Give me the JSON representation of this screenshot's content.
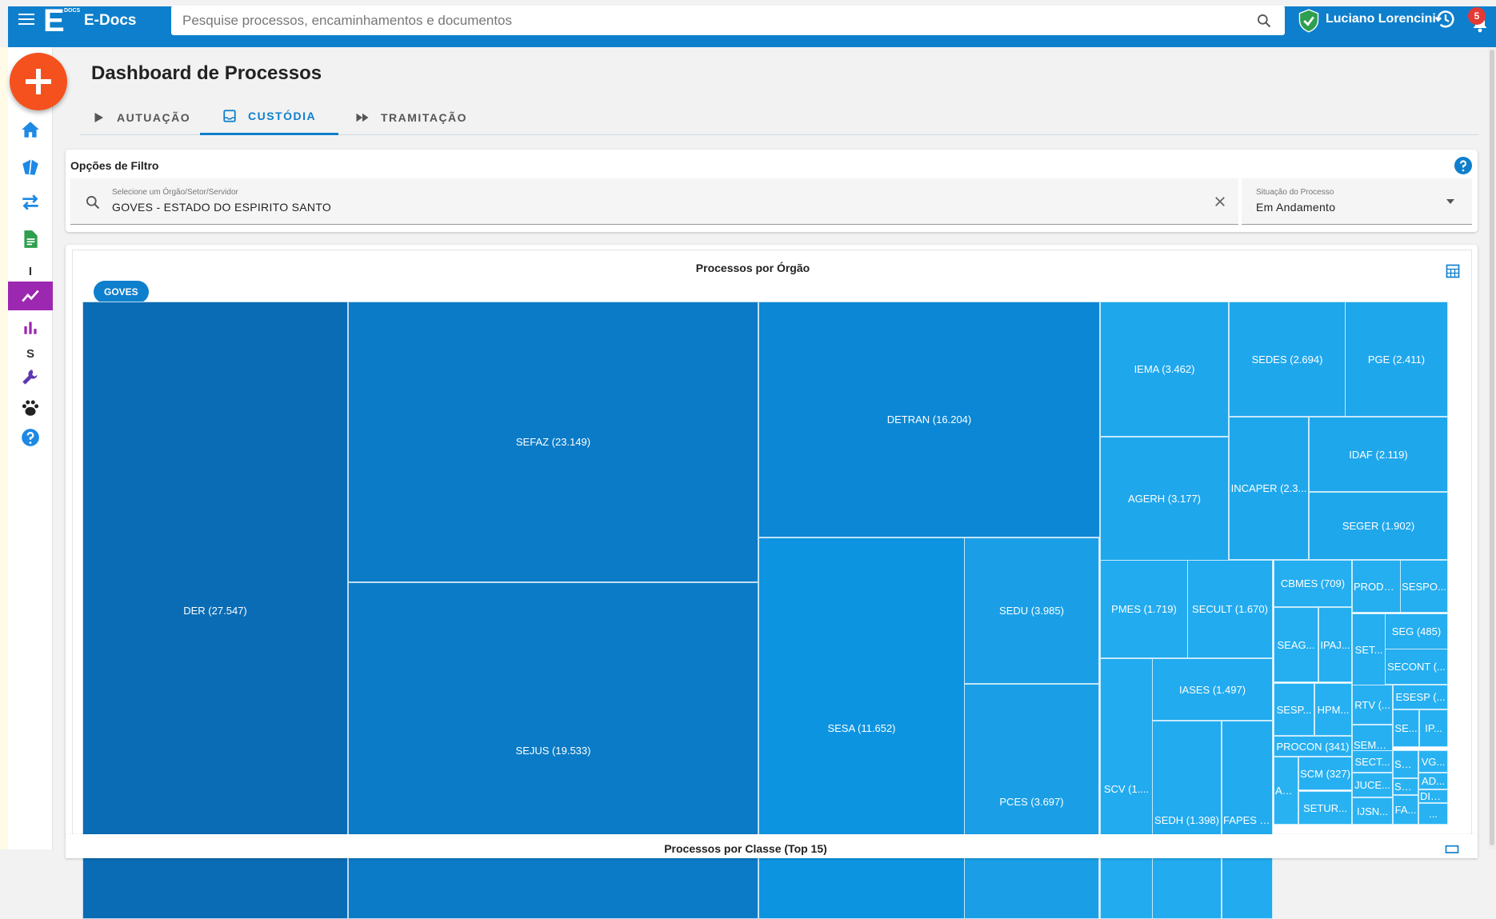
{
  "header": {
    "app_name": "E-Docs",
    "logo_letter": "E",
    "logo_docs": "DOCS",
    "search_placeholder": "Pesquise processos, encaminhamentos e documentos",
    "user_name": "Luciano Lorencini",
    "notification_count": "5"
  },
  "colors": {
    "primary": "#0e7fcc",
    "fab": "#f4511e",
    "active_rail": "#9c27b0"
  },
  "sidebar": {
    "letters": {
      "i": "I",
      "s": "S"
    },
    "icons": [
      "home-icon",
      "box-icon",
      "transfer-icon",
      "document-icon",
      "trend-chart-icon",
      "bar-chart-icon",
      "wrench-icon",
      "paw-icon",
      "help-icon"
    ]
  },
  "page": {
    "title": "Dashboard de Processos",
    "tabs": [
      {
        "label": "AUTUAÇÃO",
        "active": false
      },
      {
        "label": "CUSTÓDIA",
        "active": true
      },
      {
        "label": "TRAMITAÇÃO",
        "active": false
      }
    ]
  },
  "filter": {
    "title": "Opções de Filtro",
    "org_label": "Selecione um Órgão/Setor/Servidor",
    "org_value": "GOVES - ESTADO DO ESPIRITO SANTO",
    "status_label": "Situação do Processo",
    "status_value": "Em Andamento"
  },
  "chart": {
    "title": "Processos por Órgão",
    "chip": "GOVES",
    "next_title": "Processos por Classe (Top 15)"
  },
  "chart_data": {
    "type": "treemap",
    "title": "Processos por Órgão",
    "items": [
      {
        "label": "DER (27.547)",
        "name": "DER",
        "value": 27547
      },
      {
        "label": "SEFAZ (23.149)",
        "name": "SEFAZ",
        "value": 23149
      },
      {
        "label": "SEJUS (19.533)",
        "name": "SEJUS",
        "value": 19533
      },
      {
        "label": "DETRAN (16.204)",
        "name": "DETRAN",
        "value": 16204
      },
      {
        "label": "SESA (11.652)",
        "name": "SESA",
        "value": 11652
      },
      {
        "label": "SEDU (3.985)",
        "name": "SEDU",
        "value": 3985
      },
      {
        "label": "PCES (3.697)",
        "name": "PCES",
        "value": 3697
      },
      {
        "label": "IEMA (3.462)",
        "name": "IEMA",
        "value": 3462
      },
      {
        "label": "AGERH (3.177)",
        "name": "AGERH",
        "value": 3177
      },
      {
        "label": "SEDES (2.694)",
        "name": "SEDES",
        "value": 2694
      },
      {
        "label": "PGE (2.411)",
        "name": "PGE",
        "value": 2411
      },
      {
        "label": "INCAPER (2.3...",
        "name": "INCAPER"
      },
      {
        "label": "IDAF (2.119)",
        "name": "IDAF",
        "value": 2119
      },
      {
        "label": "SEGER (1.902)",
        "name": "SEGER",
        "value": 1902
      },
      {
        "label": "PMES (1.719)",
        "name": "PMES",
        "value": 1719
      },
      {
        "label": "SECULT (1.670)",
        "name": "SECULT",
        "value": 1670
      },
      {
        "label": "IASES (1.497)",
        "name": "IASES",
        "value": 1497
      },
      {
        "label": "SEDH (1.398)",
        "name": "SEDH",
        "value": 1398
      },
      {
        "label": "SCV (1....",
        "name": "SCV"
      },
      {
        "label": "FAPES (...",
        "name": "FAPES"
      },
      {
        "label": "CBMES (709)",
        "name": "CBMES",
        "value": 709
      },
      {
        "label": "PRODE...",
        "name": "PRODE..."
      },
      {
        "label": "SESPO...",
        "name": "SESPO..."
      },
      {
        "label": "SEAG...",
        "name": "SEAG..."
      },
      {
        "label": "IPAJ...",
        "name": "IPAJ..."
      },
      {
        "label": "SET...",
        "name": "SET..."
      },
      {
        "label": "SEG (485)",
        "name": "SEG",
        "value": 485
      },
      {
        "label": "SECONT (...",
        "name": "SECONT"
      },
      {
        "label": "SESP...",
        "name": "SESP..."
      },
      {
        "label": "HPM...",
        "name": "HPM..."
      },
      {
        "label": "RTV (...",
        "name": "RTV"
      },
      {
        "label": "ESESP (...",
        "name": "ESESP"
      },
      {
        "label": "SEMO...",
        "name": "SEMO..."
      },
      {
        "label": "SE...",
        "name": "SE..."
      },
      {
        "label": "IP...",
        "name": "IP..."
      },
      {
        "label": "PROCON (341)",
        "name": "PROCON",
        "value": 341
      },
      {
        "label": "SCM (327)",
        "name": "SCM",
        "value": 327
      },
      {
        "label": "SECT...",
        "name": "SECT..."
      },
      {
        "label": "SE...",
        "name": "SE..."
      },
      {
        "label": "VG...",
        "name": "VG..."
      },
      {
        "label": "AR...",
        "name": "AR..."
      },
      {
        "label": "AD...",
        "name": "AD..."
      },
      {
        "label": "JUCE...",
        "name": "JUCE..."
      },
      {
        "label": "SE...",
        "name": "SE..."
      },
      {
        "label": "DIO...",
        "name": "DIO..."
      },
      {
        "label": "SETUR...",
        "name": "SETUR..."
      },
      {
        "label": "IJSN...",
        "name": "IJSN..."
      },
      {
        "label": "FA...",
        "name": "FA..."
      },
      {
        "label": "...",
        "name": "..."
      }
    ]
  }
}
